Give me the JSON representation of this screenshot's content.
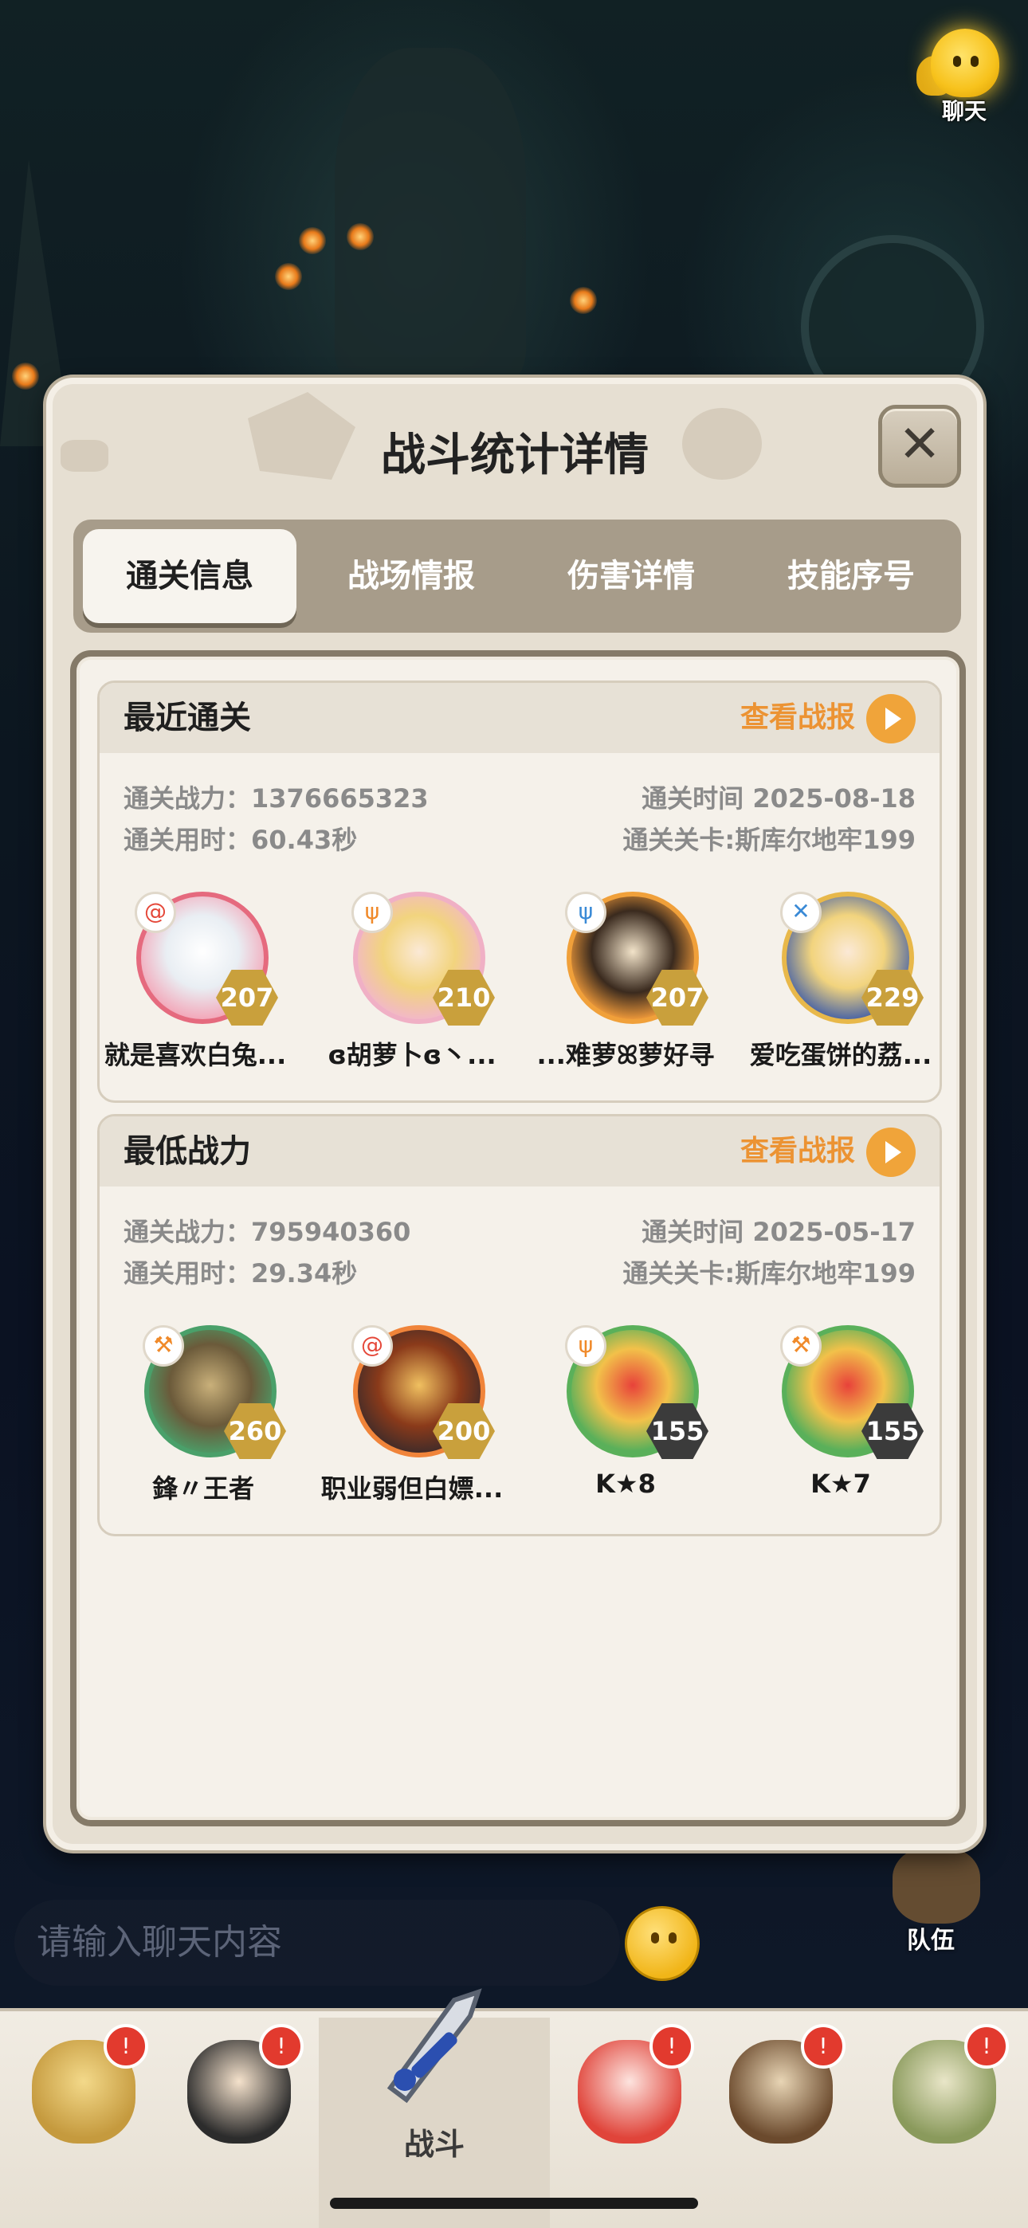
{
  "chat_top": {
    "label": "聊天"
  },
  "modal": {
    "title": "战斗统计详情",
    "close_symbol": "✕",
    "tabs": [
      {
        "label": "通关信息",
        "active": true
      },
      {
        "label": "战场情报",
        "active": false
      },
      {
        "label": "伤害详情",
        "active": false
      },
      {
        "label": "技能序号",
        "active": false
      }
    ],
    "recent": {
      "title": "最近通关",
      "report_label": "查看战报",
      "power_label": "通关战力：",
      "power_value": "1376665323",
      "time_label": "通关时间",
      "time_value": "2025-08-18",
      "duration_label": "通关用时：",
      "duration_value": "60.43秒",
      "stage_label": "通关关卡:",
      "stage_value": "斯库尔地牢199",
      "heroes": [
        {
          "name": "就是喜欢白兔...",
          "level": "207",
          "icon": "spiral-badge-icon"
        },
        {
          "name": "ɞ胡萝卜ɞ丶...",
          "level": "210",
          "icon": "trident-badge-icon"
        },
        {
          "name": "...难萝ꕤ萝好寻",
          "level": "207",
          "icon": "trident-badge-icon"
        },
        {
          "name": "爱吃蛋饼的荔...",
          "level": "229",
          "icon": "sword-badge-icon"
        }
      ]
    },
    "lowest": {
      "title": "最低战力",
      "report_label": "查看战报",
      "power_label": "通关战力：",
      "power_value": "795940360",
      "time_label": "通关时间",
      "time_value": "2025-05-17",
      "duration_label": "通关用时：",
      "duration_value": "29.34秒",
      "stage_label": "通关关卡:",
      "stage_value": "斯库尔地牢199",
      "heroes": [
        {
          "name": "鋒〃王者",
          "level": "260",
          "icon": "axe-badge-icon"
        },
        {
          "name": "职业弱但白嫖...",
          "level": "200",
          "icon": "spiral-badge-icon"
        },
        {
          "name": "K★8",
          "level": "155",
          "icon": "trident-badge-icon"
        },
        {
          "name": "K★7",
          "level": "155",
          "icon": "axe-badge-icon"
        }
      ]
    }
  },
  "chat_input": {
    "placeholder": "请输入聊天内容"
  },
  "team_label": "队伍",
  "bottom_nav": {
    "battle_label": "战斗",
    "bell_symbol": "!"
  },
  "colors": {
    "accent_orange": "#ec9333",
    "panel_bg": "#e6dfd2",
    "tab_bar": "#a79c8a",
    "level_gold": "#c9a03c"
  }
}
